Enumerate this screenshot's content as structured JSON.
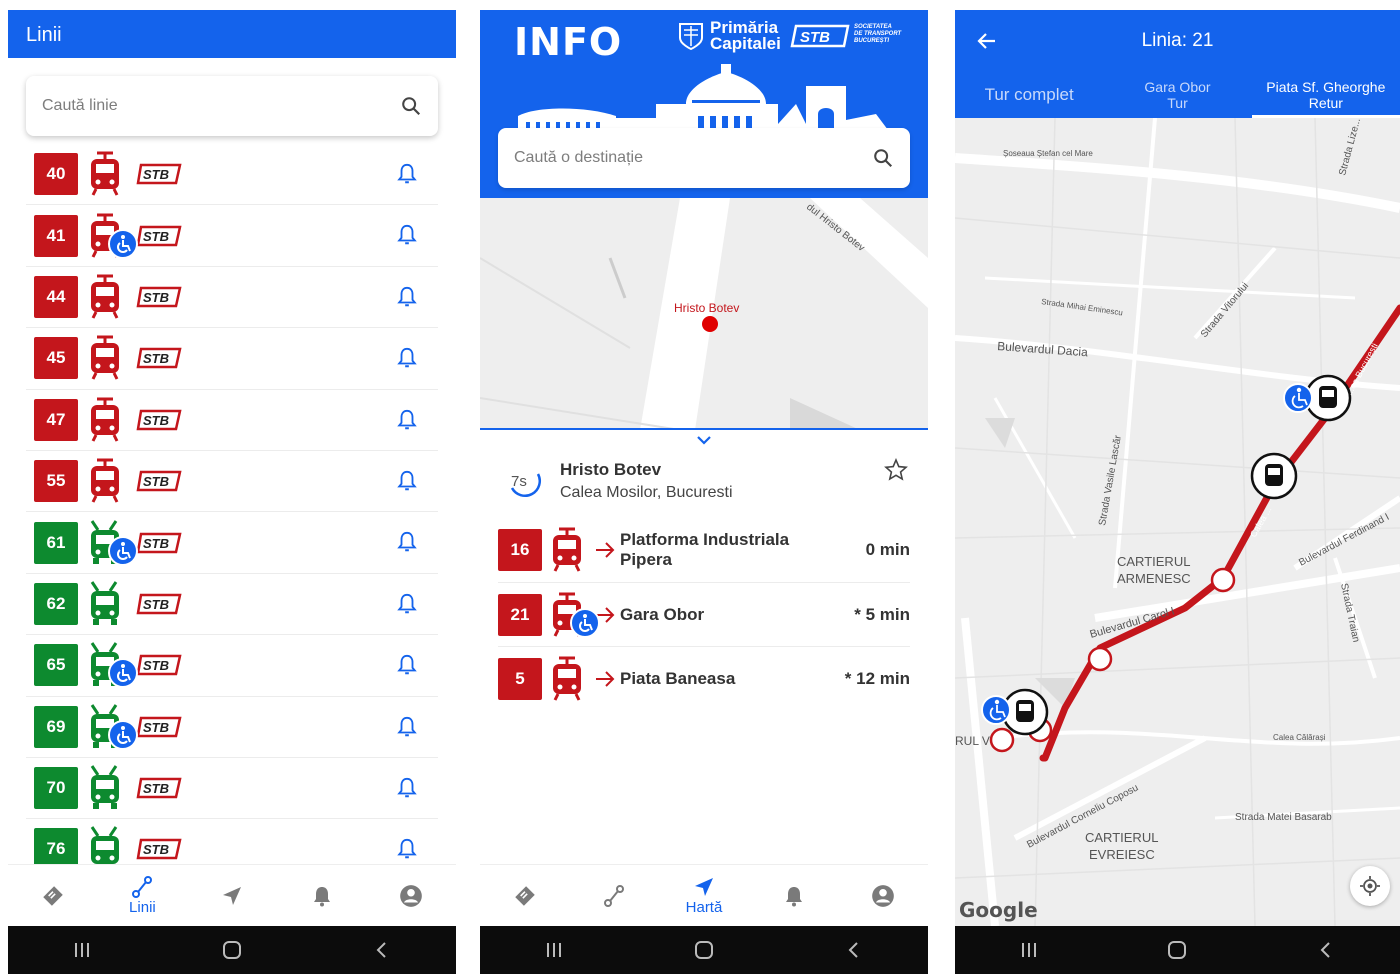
{
  "colors": {
    "primary": "#1463ec",
    "tram_red": "#c4161c",
    "trolley_green": "#0d8a2f",
    "route": "#c4161c"
  },
  "lines_screen": {
    "title": "Linii",
    "search_placeholder": "Caută linie",
    "lines": [
      {
        "number": "40",
        "type": "tram",
        "accessible": false
      },
      {
        "number": "41",
        "type": "tram",
        "accessible": true
      },
      {
        "number": "44",
        "type": "tram",
        "accessible": false
      },
      {
        "number": "45",
        "type": "tram",
        "accessible": false
      },
      {
        "number": "47",
        "type": "tram",
        "accessible": false
      },
      {
        "number": "55",
        "type": "tram",
        "accessible": false
      },
      {
        "number": "61",
        "type": "trolleybus",
        "accessible": true
      },
      {
        "number": "62",
        "type": "trolleybus",
        "accessible": false
      },
      {
        "number": "65",
        "type": "trolleybus",
        "accessible": true
      },
      {
        "number": "69",
        "type": "trolleybus",
        "accessible": true
      },
      {
        "number": "70",
        "type": "trolleybus",
        "accessible": false
      },
      {
        "number": "76",
        "type": "trolleybus",
        "accessible": false
      }
    ],
    "nav_active_label": "Linii"
  },
  "map_screen": {
    "logo_text": "INFO",
    "primaria_line1": "Primăria",
    "primaria_line2": "Capitalei",
    "stb_sub": [
      "SOCIETATEA",
      "DE TRANSPORT",
      "BUCUREȘTI"
    ],
    "search_placeholder": "Caută o destinație",
    "map_street": "Strada Hristo Botev",
    "map_street_display": "dul Hristo Botev",
    "map_stop_label": "Hristo Botev",
    "stop": {
      "name": "Hristo Botev",
      "address": "Calea Mosilor, Bucuresti",
      "refresh": "7s"
    },
    "arrivals": [
      {
        "line": "16",
        "dest1": "Platforma Industriala",
        "dest2": "Pipera",
        "time": "0 min",
        "accessible": false
      },
      {
        "line": "21",
        "dest1": "Gara Obor",
        "dest2": "",
        "time": "* 5 min",
        "accessible": true
      },
      {
        "line": "5",
        "dest1": "Piata Baneasa",
        "dest2": "",
        "time": "* 12 min",
        "accessible": false
      }
    ],
    "nav_active_label": "Hartă"
  },
  "route_screen": {
    "title": "Linia: 21",
    "tabs": [
      {
        "label1": "Tur complet",
        "label2": ""
      },
      {
        "label1": "Gara Obor",
        "label2": "Tur"
      },
      {
        "label1": "Piata Sf. Gheorghe",
        "label2": "Retur"
      }
    ],
    "map_labels": {
      "soseaua": "Șoseaua Ștefan cel Mare",
      "lizeanu": "Strada Lize...",
      "eminescu": "Strada Mihai Eminescu",
      "vitorului": "Strada Vitorului",
      "dacia": "Bulevardul Dacia",
      "lascar": "Strada Vasile Lascăr",
      "ferdinand": "Bulevardul Ferdinand I",
      "traian": "Strada Traian",
      "calea": "Calea ...",
      "bucuresti": "...ea București",
      "cartierul_armenesc_1": "CARTIERUL",
      "cartierul_armenesc_2": "ARMENESC",
      "carol": "Bulevardul Carol I",
      "rul": "RUL V",
      "calarasi": "Calea Călărași",
      "coposu": "Bulevardul Corneliu Coposu",
      "basarab": "Strada Matei Basarab",
      "evreiesc_1": "CARTIERUL",
      "evreiesc_2": "EVREIESC",
      "google": "Google"
    }
  }
}
